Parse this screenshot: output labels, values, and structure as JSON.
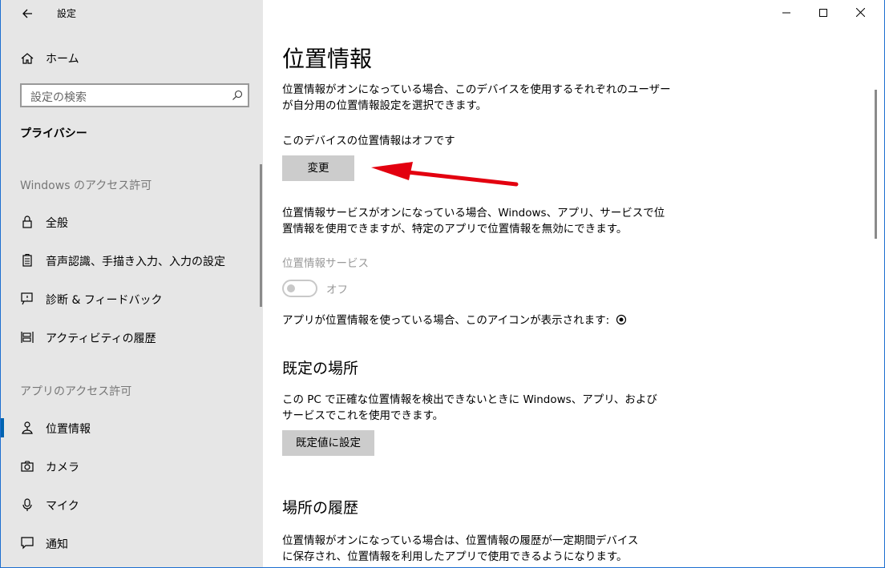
{
  "window": {
    "title": "設定",
    "minimize_icon": "minimize-icon",
    "maximize_icon": "maximize-icon",
    "close_icon": "close-icon"
  },
  "sidebar": {
    "home_label": "ホーム",
    "search_placeholder": "設定の検索",
    "section_title": "プライバシー",
    "group1_header": "Windows のアクセス許可",
    "group1_items": [
      {
        "label": "全般",
        "icon": "lock-icon"
      },
      {
        "label": "音声認識、手描き入力、入力の設定",
        "icon": "clipboard-icon"
      },
      {
        "label": "診断 & フィードバック",
        "icon": "feedback-icon"
      },
      {
        "label": "アクティビティの履歴",
        "icon": "timeline-icon"
      }
    ],
    "group2_header": "アプリのアクセス許可",
    "group2_items": [
      {
        "label": "位置情報",
        "icon": "location-icon",
        "active": true
      },
      {
        "label": "カメラ",
        "icon": "camera-icon"
      },
      {
        "label": "マイク",
        "icon": "microphone-icon"
      },
      {
        "label": "通知",
        "icon": "notification-icon"
      }
    ]
  },
  "main": {
    "title": "位置情報",
    "intro_line1": "位置情報がオンになっている場合、このデバイスを使用するそれぞれのユーザー",
    "intro_line2": "が自分用の位置情報設定を選択できます。",
    "device_status": "このデバイスの位置情報はオフです",
    "change_button": "変更",
    "service_desc_line1": "位置情報サービスがオンになっている場合、Windows、アプリ、サービスで位",
    "service_desc_line2": "置情報を使用できますが、特定のアプリで位置情報を無効にできます。",
    "service_label": "位置情報サービス",
    "toggle_state": "オフ",
    "icon_note": "アプリが位置情報を使っている場合、このアイコンが表示されます:",
    "default_location": {
      "title": "既定の場所",
      "desc_line1": "この PC で正確な位置情報を検出できないときに Windows、アプリ、および",
      "desc_line2": "サービスでこれを使用できます。",
      "button": "既定値に設定"
    },
    "history": {
      "title": "場所の履歴",
      "desc_line1": "位置情報がオンになっている場合は、位置情報の履歴が一定期間デバイス",
      "desc_line2": "に保存され、位置情報を利用したアプリで使用できるようになります。"
    }
  },
  "colors": {
    "sidebar_bg": "#e6e6e6",
    "accent": "#0063b1",
    "button_bg": "#cccccc",
    "annotation_arrow": "#e3000f",
    "window_border": "#1e6fd0"
  }
}
